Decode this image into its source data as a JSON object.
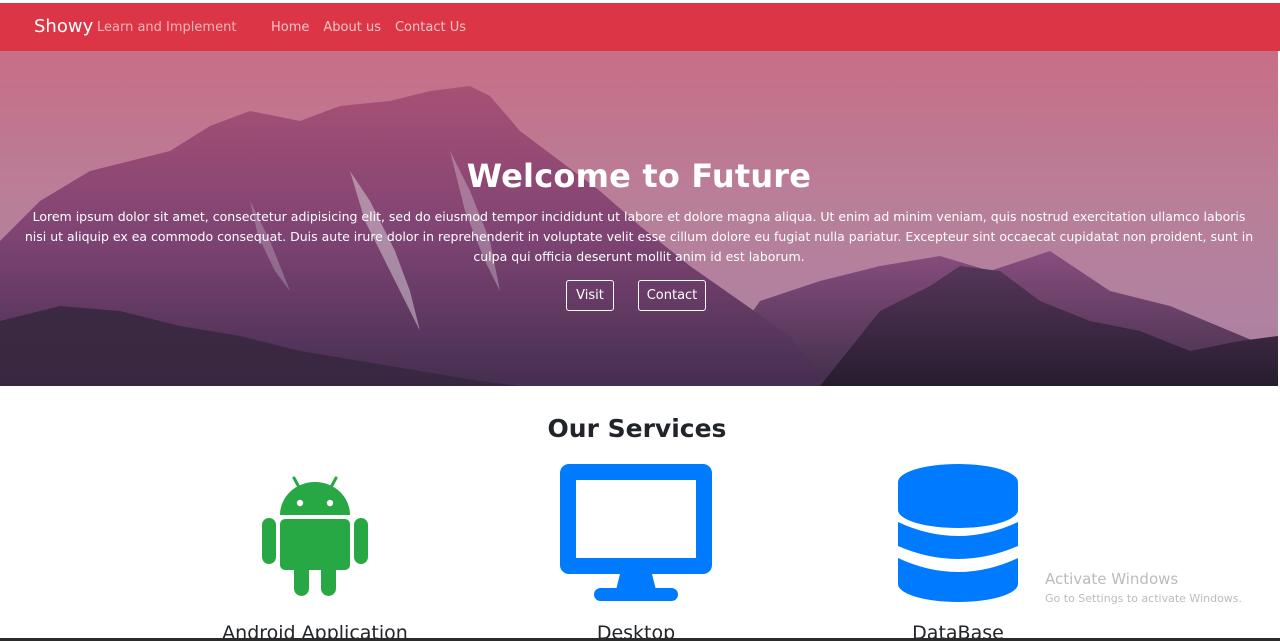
{
  "navbar": {
    "brand": "Showy",
    "tagline": "Learn and Implement",
    "links": [
      "Home",
      "About us",
      "Contact Us"
    ],
    "color": "#dc3545"
  },
  "hero": {
    "title": "Welcome to Future",
    "text": "Lorem ipsum dolor sit amet, consectetur adipisicing elit, sed do eiusmod tempor incididunt ut labore et dolore magna aliqua. Ut enim ad minim veniam, quis nostrud exercitation ullamco laboris nisi ut aliquip ex ea commodo consequat. Duis aute irure dolor in reprehenderit in voluptate velit esse cillum dolore eu fugiat nulla pariatur. Excepteur sint occaecat cupidatat non proident, sunt in culpa qui officia deserunt mollit anim id est laborum.",
    "buttons": {
      "visit": "Visit",
      "contact": "Contact"
    }
  },
  "services": {
    "title": "Our Services",
    "items": [
      {
        "label": "Android Application",
        "icon": "android-icon",
        "color": "#28a745"
      },
      {
        "label": "Desktop",
        "icon": "desktop-icon",
        "color": "#007bff"
      },
      {
        "label": "DataBase",
        "icon": "database-icon",
        "color": "#007bff"
      }
    ]
  },
  "watermark": {
    "title": "Activate Windows",
    "subtitle": "Go to Settings to activate Windows."
  }
}
